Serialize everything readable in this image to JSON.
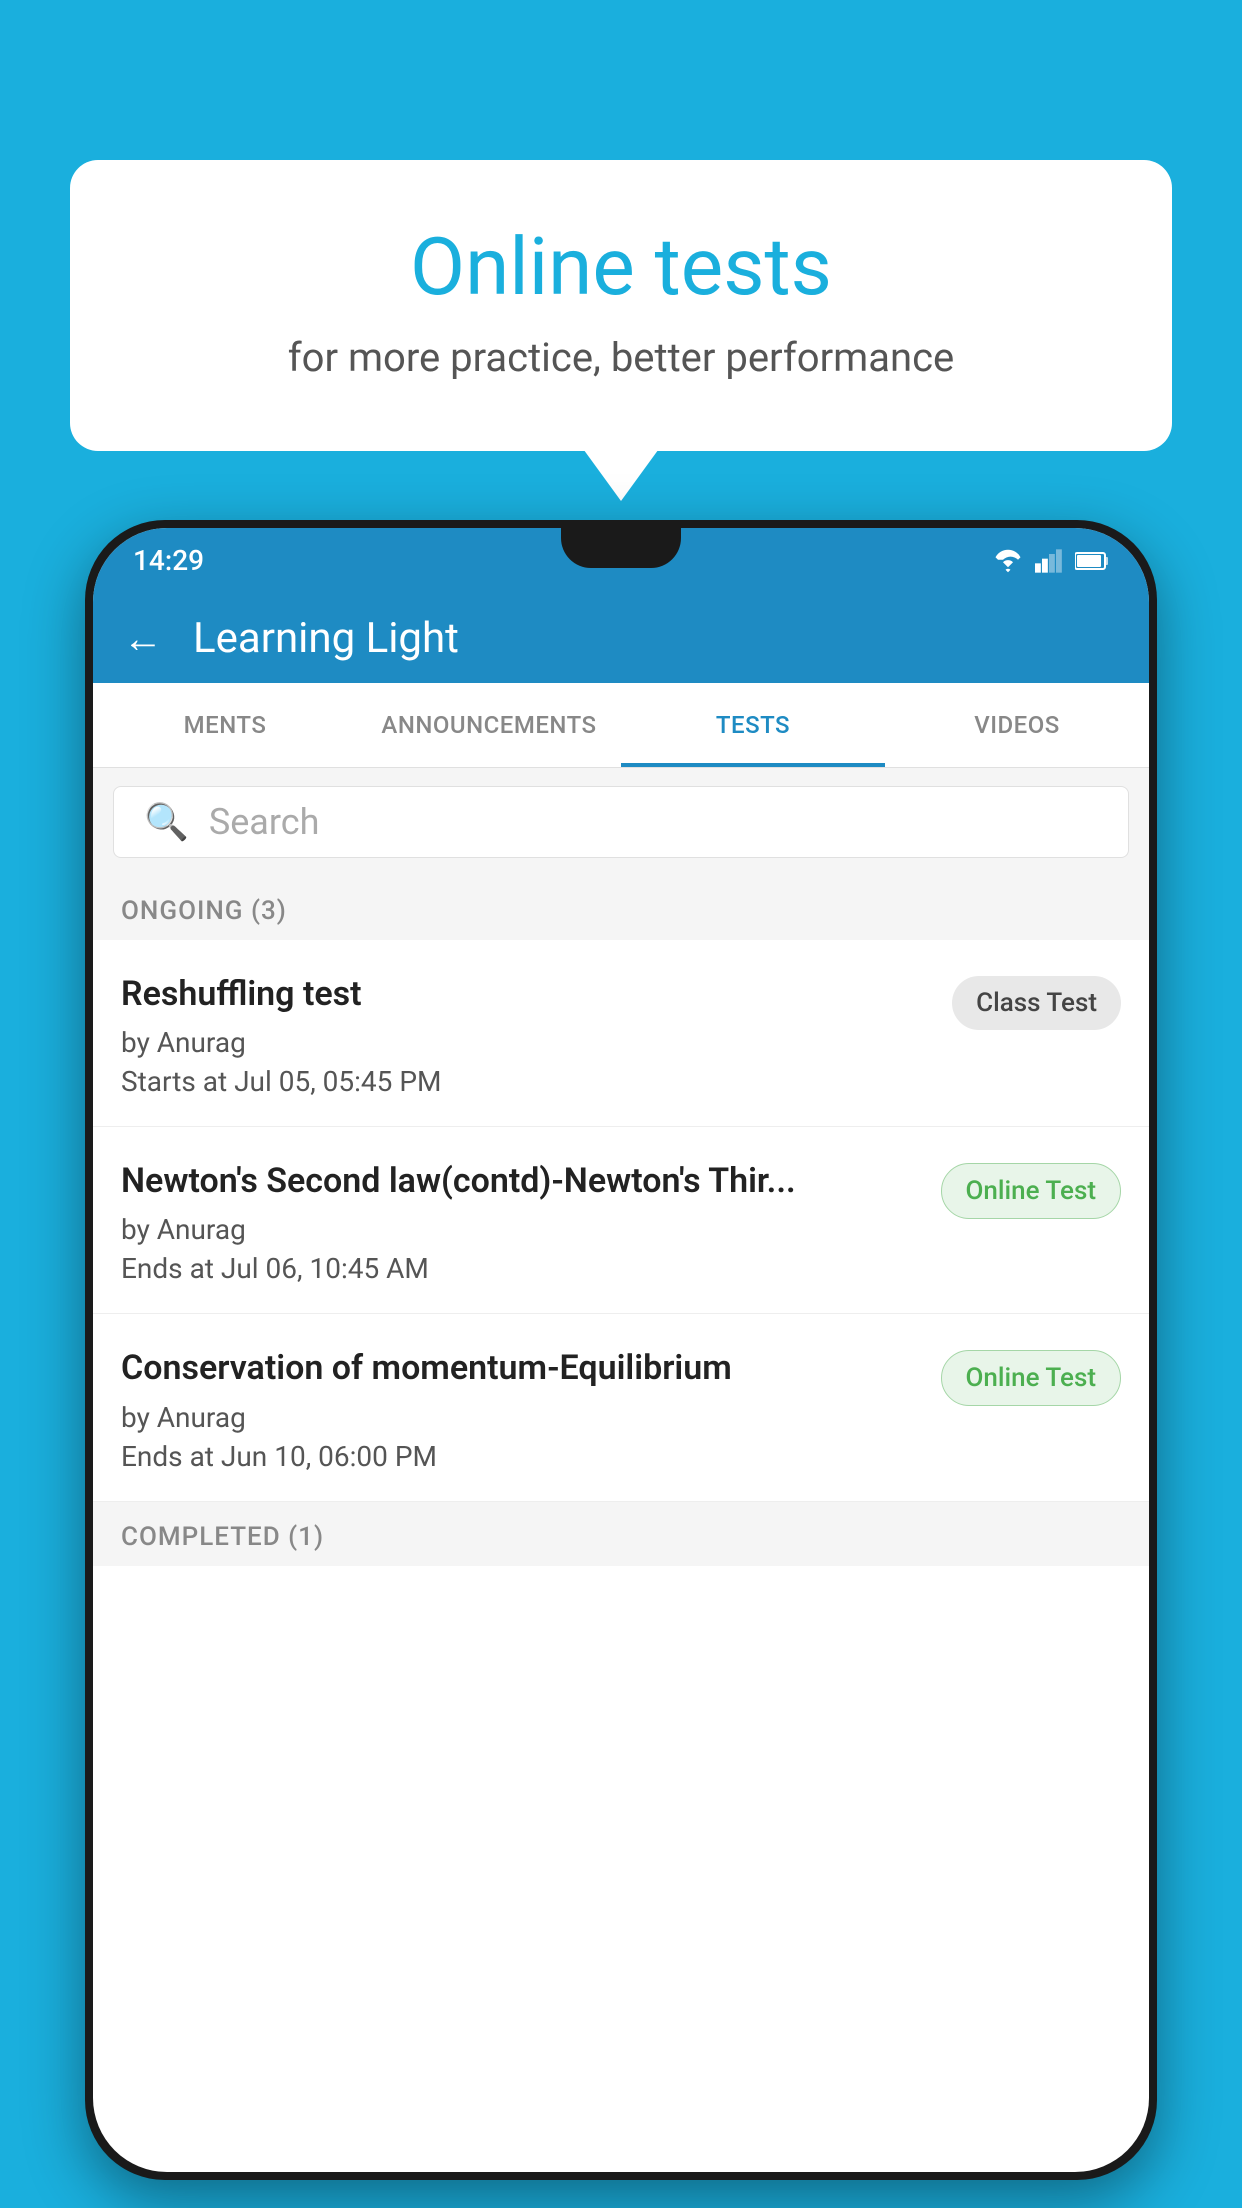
{
  "background_color": "#1AAFDD",
  "bubble": {
    "title": "Online tests",
    "subtitle": "for more practice, better performance"
  },
  "status_bar": {
    "time": "14:29",
    "wifi_icon": "wifi-icon",
    "signal_icon": "signal-icon",
    "battery_icon": "battery-icon"
  },
  "app_header": {
    "back_label": "←",
    "title": "Learning Light"
  },
  "tabs": [
    {
      "label": "MENTS",
      "active": false
    },
    {
      "label": "ANNOUNCEMENTS",
      "active": false
    },
    {
      "label": "TESTS",
      "active": true
    },
    {
      "label": "VIDEOS",
      "active": false
    }
  ],
  "search": {
    "placeholder": "Search"
  },
  "ongoing_section": {
    "label": "ONGOING (3)"
  },
  "tests": [
    {
      "title": "Reshuffling test",
      "author": "by Anurag",
      "time_label": "Starts at",
      "time": "Jul 05, 05:45 PM",
      "badge": "Class Test",
      "badge_type": "class"
    },
    {
      "title": "Newton's Second law(contd)-Newton's Thir...",
      "author": "by Anurag",
      "time_label": "Ends at",
      "time": "Jul 06, 10:45 AM",
      "badge": "Online Test",
      "badge_type": "online"
    },
    {
      "title": "Conservation of momentum-Equilibrium",
      "author": "by Anurag",
      "time_label": "Ends at",
      "time": "Jun 10, 06:00 PM",
      "badge": "Online Test",
      "badge_type": "online"
    }
  ],
  "completed_section": {
    "label": "COMPLETED (1)"
  }
}
